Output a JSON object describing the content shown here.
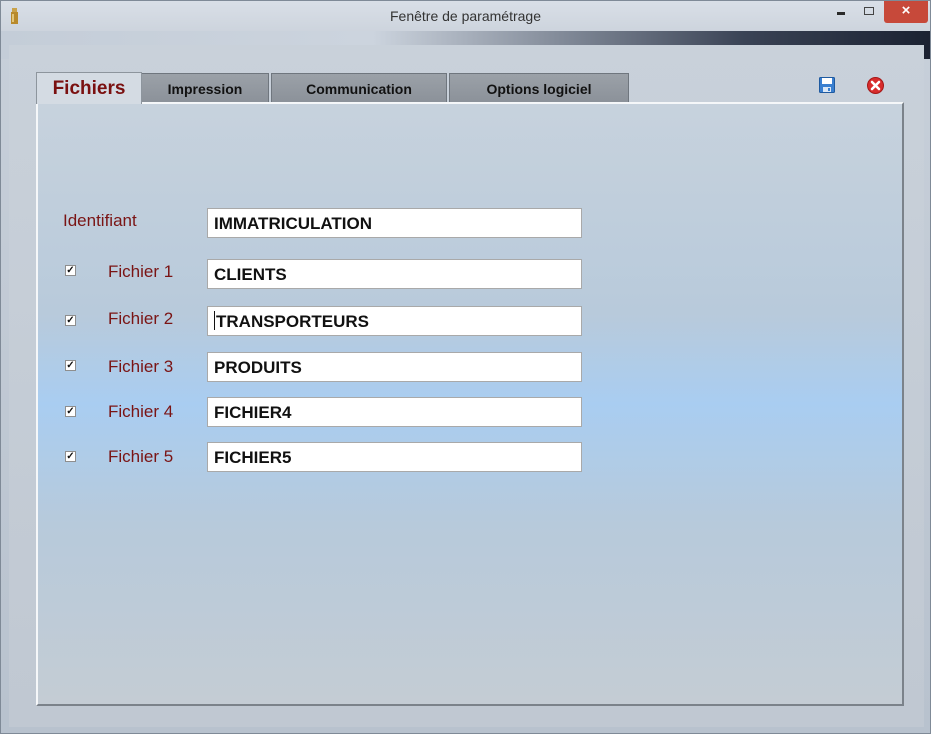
{
  "window": {
    "title": "Fenêtre de paramétrage",
    "close_glyph": "×"
  },
  "tabs": [
    {
      "label": "Fichiers",
      "active": true
    },
    {
      "label": "Impression",
      "active": false
    },
    {
      "label": "Communication",
      "active": false
    },
    {
      "label": "Options logiciel",
      "active": false
    }
  ],
  "toolbar": {
    "save_icon": "save-icon",
    "close_icon": "close-icon"
  },
  "form": {
    "identifiant_label": "Identifiant",
    "identifiant_value": "IMMATRICULATION",
    "check_glyph": "✓",
    "rows": [
      {
        "label": "Fichier 1",
        "checked": true,
        "value": "CLIENTS"
      },
      {
        "label": "Fichier 2",
        "checked": true,
        "value": "TRANSPORTEURS"
      },
      {
        "label": "Fichier 3",
        "checked": true,
        "value": "PRODUITS"
      },
      {
        "label": "Fichier 4",
        "checked": true,
        "value": "FICHIER4"
      },
      {
        "label": "Fichier 5",
        "checked": true,
        "value": "FICHIER5"
      }
    ]
  },
  "colors": {
    "label_color": "#7a1414",
    "close_button": "#c7493a"
  }
}
